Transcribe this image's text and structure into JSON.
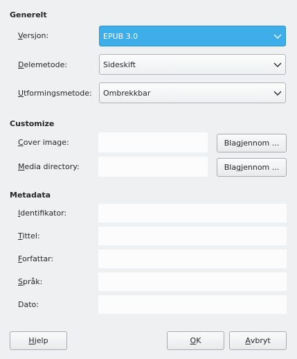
{
  "sections": {
    "general": "Generelt",
    "customize": "Customize",
    "metadata": "Metadata"
  },
  "general": {
    "version": {
      "label_mn": "V",
      "label_rest": "ersjon:",
      "value": "EPUB 3.0"
    },
    "split": {
      "label_mn": "D",
      "label_rest": "elemetode:",
      "value": "Sideskift"
    },
    "layout": {
      "label_mn": "U",
      "label_rest": "tformingsmetode:",
      "value": "Ombrekkbar"
    }
  },
  "customize": {
    "cover": {
      "label_mn": "C",
      "label_rest": "over image:",
      "value": ""
    },
    "media": {
      "label_mn": "M",
      "label_rest": "edia directory:",
      "value": ""
    },
    "browse_pre": "Bla ",
    "browse_mn": "g",
    "browse_post": "jennom ..."
  },
  "metadata": {
    "identifier": {
      "label_mn": "I",
      "label_rest": "dentifikator:",
      "value": ""
    },
    "title": {
      "label_mn": "T",
      "label_rest": "ittel:",
      "value": ""
    },
    "author": {
      "label_mn": "F",
      "label_rest": "orfattar:",
      "value": ""
    },
    "language": {
      "label_mn": "S",
      "label_rest": "pråk:",
      "value": ""
    },
    "date": {
      "label": "Dato:",
      "value": ""
    }
  },
  "buttons": {
    "help_mn": "H",
    "help_rest": "jelp",
    "ok_mn": "O",
    "ok_rest": "K",
    "cancel_mn": "A",
    "cancel_rest": "vbryt"
  },
  "colors": {
    "accent": "#3daee9",
    "window": "#eff0f1",
    "field": "#fcfcfc"
  },
  "icons": {
    "dropdown": "chevron-down-icon"
  }
}
